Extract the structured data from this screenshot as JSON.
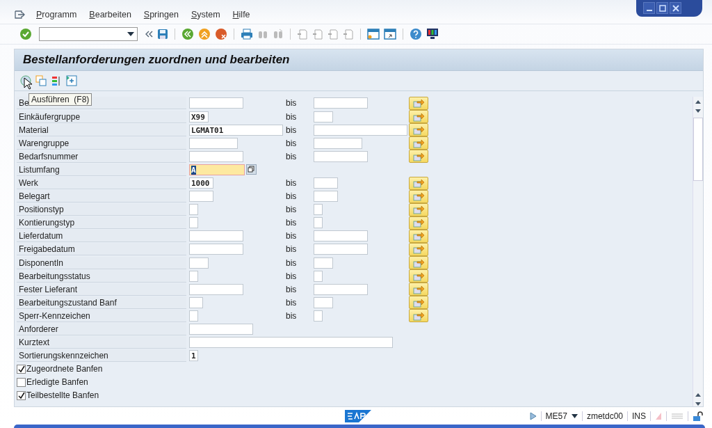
{
  "menu": [
    "Programm",
    "Bearbeiten",
    "Springen",
    "System",
    "Hilfe"
  ],
  "screen_title": "Bestellanforderungen zuordnen und bearbeiten",
  "tooltip": "Ausführen  (F8)",
  "fields": [
    {
      "kind": "range",
      "label": "Be",
      "range_label": "bis"
    },
    {
      "kind": "range",
      "label": "Einkäufergruppe",
      "low": "X99",
      "range_label": "bis"
    },
    {
      "kind": "range",
      "label": "Material",
      "low": "LGMAT01",
      "range_label": "bis"
    },
    {
      "kind": "range",
      "label": "Warengruppe",
      "range_label": "bis"
    },
    {
      "kind": "range",
      "label": "Bedarfsnummer",
      "range_label": "bis"
    },
    {
      "kind": "select",
      "label": "Listumfang",
      "low": "A",
      "focused": true
    },
    {
      "kind": "range",
      "label": "Werk",
      "low": "1000",
      "range_label": "bis"
    },
    {
      "kind": "range",
      "label": "Belegart",
      "range_label": "bis"
    },
    {
      "kind": "range",
      "label": "Positionstyp",
      "range_label": "bis"
    },
    {
      "kind": "range",
      "label": "Kontierungstyp",
      "range_label": "bis"
    },
    {
      "kind": "range",
      "label": "Lieferdatum",
      "range_label": "bis"
    },
    {
      "kind": "range",
      "label": "Freigabedatum",
      "range_label": "bis"
    },
    {
      "kind": "range",
      "label": "DisponentIn",
      "range_label": "bis"
    },
    {
      "kind": "range",
      "label": "Bearbeitungsstatus",
      "range_label": "bis"
    },
    {
      "kind": "range",
      "label": "Fester Lieferant",
      "range_label": "bis"
    },
    {
      "kind": "range",
      "label": "Bearbeitungszustand Banf",
      "range_label": "bis"
    },
    {
      "kind": "range",
      "label": "Sperr-Kennzeichen",
      "range_label": "bis"
    },
    {
      "kind": "single",
      "label": "Anforderer"
    },
    {
      "kind": "single",
      "label": "Kurztext"
    },
    {
      "kind": "single",
      "label": "Sortierungskennzeichen",
      "low": "1"
    }
  ],
  "checkboxes": [
    {
      "label": "Zugeordnete Banfen",
      "checked": true
    },
    {
      "label": "Erledigte Banfen",
      "checked": false
    },
    {
      "label": "Teilbestellte Banfen",
      "checked": true
    }
  ],
  "status_bar": {
    "transaction": "ME57",
    "server": "zmetdc00",
    "mode": "INS"
  }
}
